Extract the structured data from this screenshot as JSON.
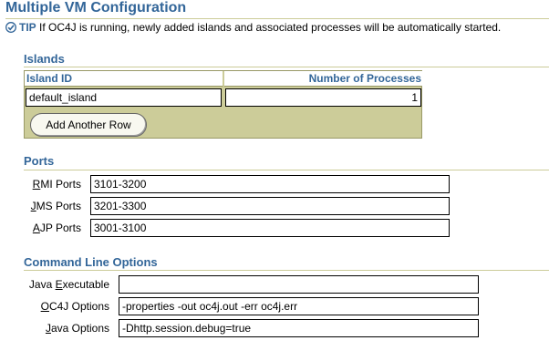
{
  "page": {
    "title": "Multiple VM Configuration",
    "tip_label": "TIP",
    "tip_text": " If OC4J is running, newly added islands and associated processes will be automatically started."
  },
  "islands": {
    "header": "Islands",
    "columns": [
      "Island ID",
      "Number of Processes"
    ],
    "rows": [
      {
        "island_id": "default_island",
        "num_processes": "1"
      }
    ],
    "add_row_label": "Add Another Row"
  },
  "ports": {
    "header": "Ports",
    "fields": [
      {
        "accesskey": "R",
        "rest": "MI Ports",
        "value": "3101-3200"
      },
      {
        "accesskey": "J",
        "rest": "MS Ports",
        "value": "3201-3300"
      },
      {
        "accesskey": "A",
        "rest": "JP Ports",
        "value": "3001-3100"
      }
    ]
  },
  "command_line": {
    "header": "Command Line Options",
    "fields": [
      {
        "pre": "Java ",
        "accesskey": "E",
        "rest": "xecutable",
        "value": ""
      },
      {
        "pre": "",
        "accesskey": "O",
        "rest": "C4J Options",
        "value": "-properties -out oc4j.out -err oc4j.err"
      },
      {
        "pre": "",
        "accesskey": "J",
        "rest": "ava Options",
        "value": "-Dhttp.session.debug=true"
      }
    ]
  },
  "colors": {
    "header_blue": "#336699",
    "table_tan": "#cccc99"
  },
  "icons": {
    "tip": "check-circle-icon"
  }
}
